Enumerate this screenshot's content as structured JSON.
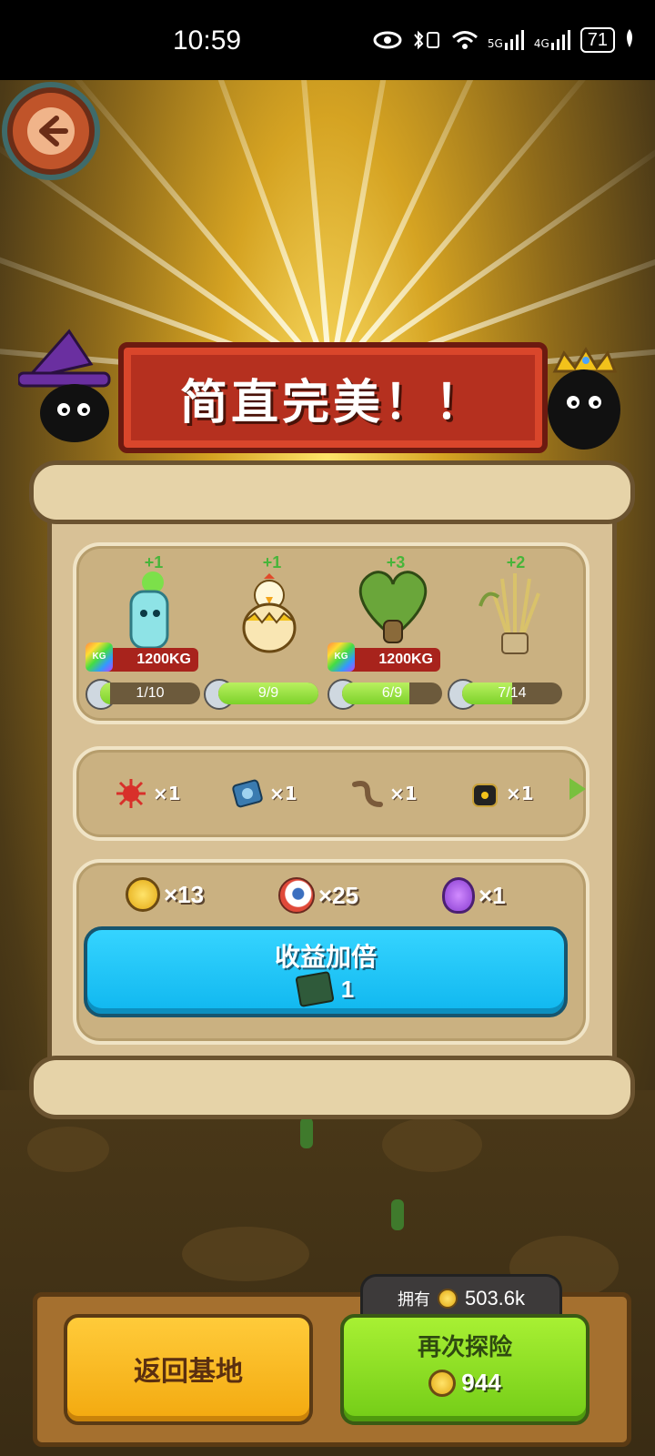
{
  "status_bar": {
    "time": "10:59",
    "battery": "71",
    "network_1": "5G",
    "network_2": "4G"
  },
  "banner": {
    "title": "简直完美！！"
  },
  "creatures": [
    {
      "plus": "+1",
      "weight": "1200KG",
      "progress": "1/10",
      "fill": 0.1,
      "icon": "cactus-ghost-creature"
    },
    {
      "plus": "+1",
      "weight": "",
      "progress": "9/9",
      "fill": 1.0,
      "icon": "chick-egg-creature"
    },
    {
      "plus": "+3",
      "weight": "1200KG",
      "progress": "6/9",
      "fill": 0.67,
      "icon": "heart-cactus-creature"
    },
    {
      "plus": "+2",
      "weight": "",
      "progress": "7/14",
      "fill": 0.5,
      "icon": "wheat-bundle-creature"
    }
  ],
  "kg_logo": "KG",
  "items": [
    {
      "icon": "red-spiky-icon",
      "count": "×1"
    },
    {
      "icon": "blue-gear-icon",
      "count": "×1"
    },
    {
      "icon": "worm-icon",
      "count": "×1"
    },
    {
      "icon": "black-bag-icon",
      "count": "×1"
    }
  ],
  "rewards": [
    {
      "icon": "coin-icon",
      "count": "×13"
    },
    {
      "icon": "eyeball-icon",
      "count": "×25"
    },
    {
      "icon": "potion-icon",
      "count": "×1"
    }
  ],
  "double_button": {
    "label": "收益加倍",
    "cost": "1",
    "icon": "ticket-icon"
  },
  "owned": {
    "label": "拥有",
    "value": "503.6k"
  },
  "return_button": {
    "label": "返回基地"
  },
  "again_button": {
    "label": "再次探险",
    "cost": "944"
  }
}
